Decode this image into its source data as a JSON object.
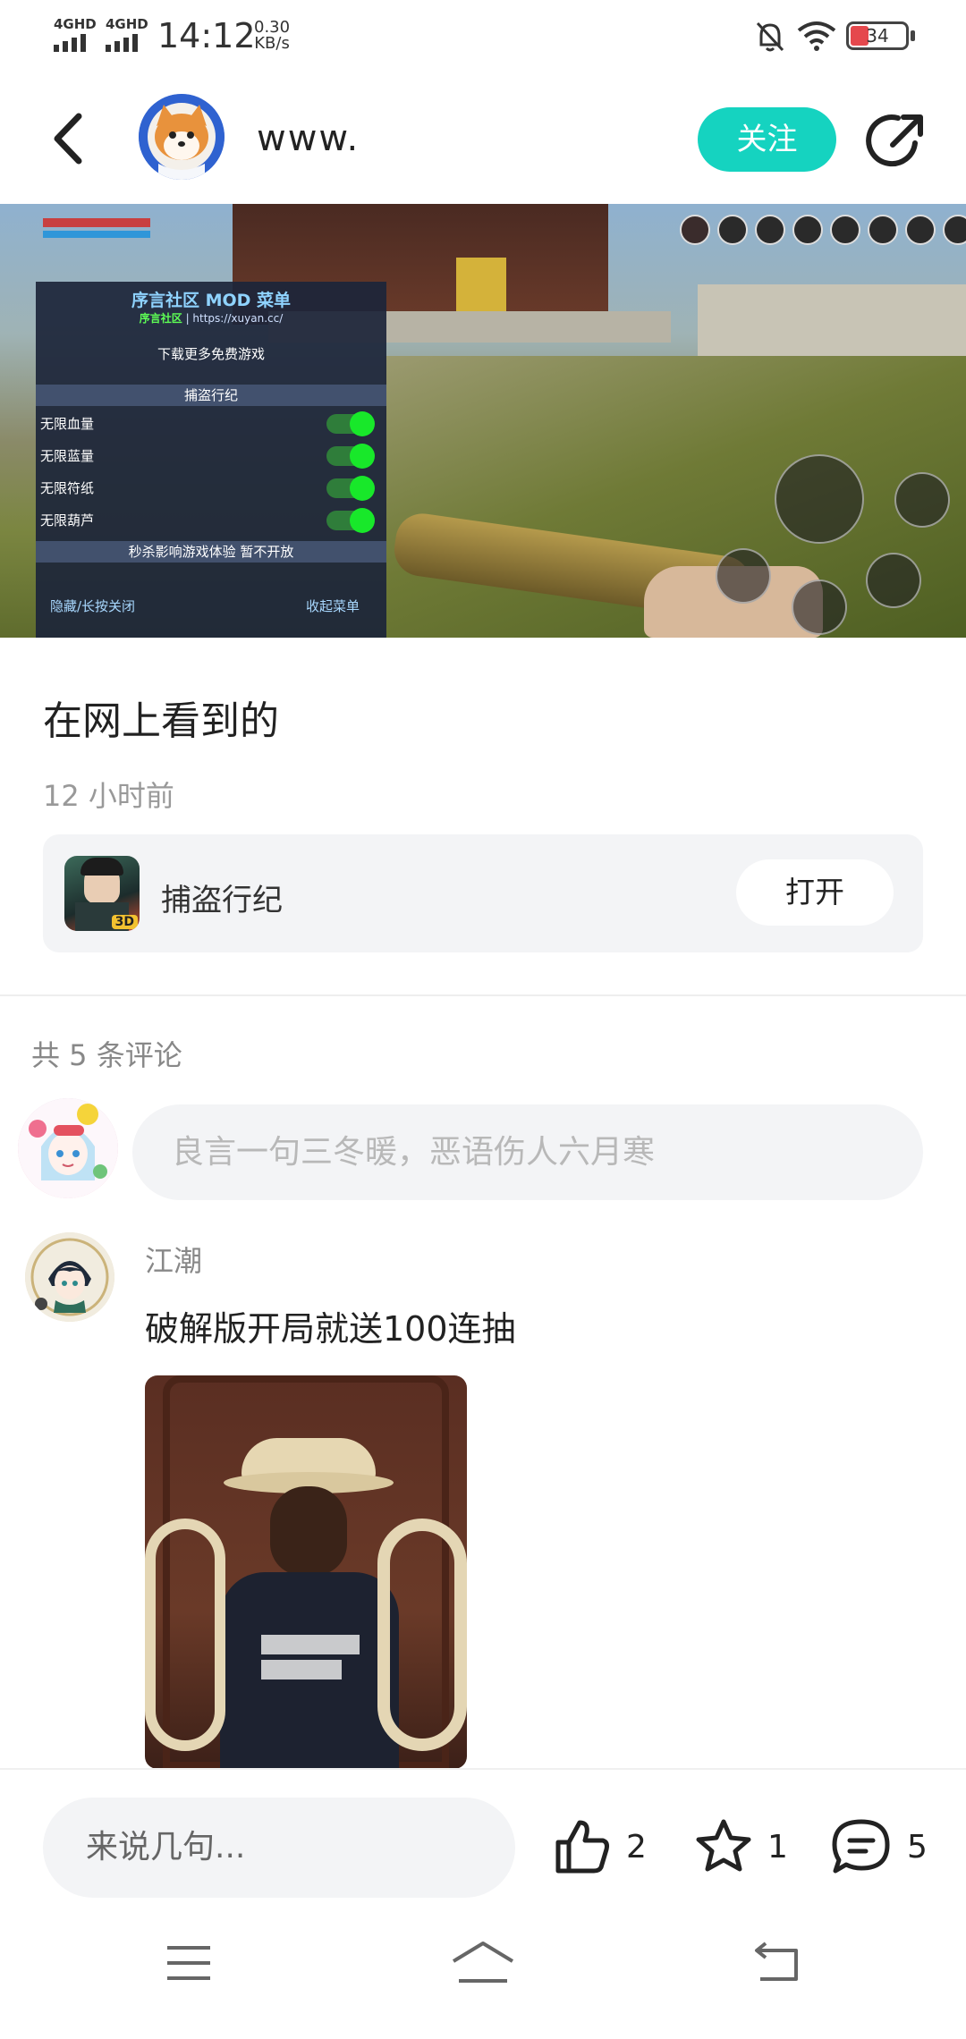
{
  "status_bar": {
    "network1": "4GHD",
    "network2": "4GHD",
    "time": "14:12",
    "speed_value": "0.30",
    "speed_unit": "KB/s",
    "battery": "34",
    "battery_color": "#e5484d"
  },
  "header": {
    "account_name": "www.",
    "follow_label": "关注",
    "accent_color": "#15d3c0"
  },
  "media": {
    "mod_menu": {
      "title": "序言社区 MOD 菜单",
      "subtitle_brand": "序言社区",
      "subtitle_url": "| https://xuyan.cc/",
      "download": "下载更多免费游戏",
      "section": "捕盗行纪",
      "options": [
        {
          "label": "无限血量"
        },
        {
          "label": "无限蓝量"
        },
        {
          "label": "无限符纸"
        },
        {
          "label": "无限葫芦"
        }
      ],
      "notice": "秒杀影响游戏体验 暂不开放",
      "hide_label": "隐藏/长按关闭",
      "collapse_label": "收起菜单"
    }
  },
  "post": {
    "title": "在网上看到的",
    "time": "12 小时前",
    "app": {
      "name": "捕盗行纪",
      "open_label": "打开",
      "badge": "3D"
    }
  },
  "comments": {
    "count_label": "共 5 条评论",
    "input_placeholder": "良言一句三冬暖，恶语伤人六月寒",
    "items": [
      {
        "author": "江潮",
        "text": "破解版开局就送100连抽"
      }
    ]
  },
  "bottom_bar": {
    "say_placeholder": "来说几句...",
    "likes": "2",
    "favorites": "1",
    "comments": "5"
  },
  "icons": {
    "back": "back-arrow-icon",
    "share": "share-icon",
    "like": "thumbs-up-icon",
    "favorite": "star-icon",
    "comment": "comment-bubble-icon",
    "nav_menu": "menu-icon",
    "nav_home": "home-icon",
    "nav_back": "back-nav-icon"
  }
}
